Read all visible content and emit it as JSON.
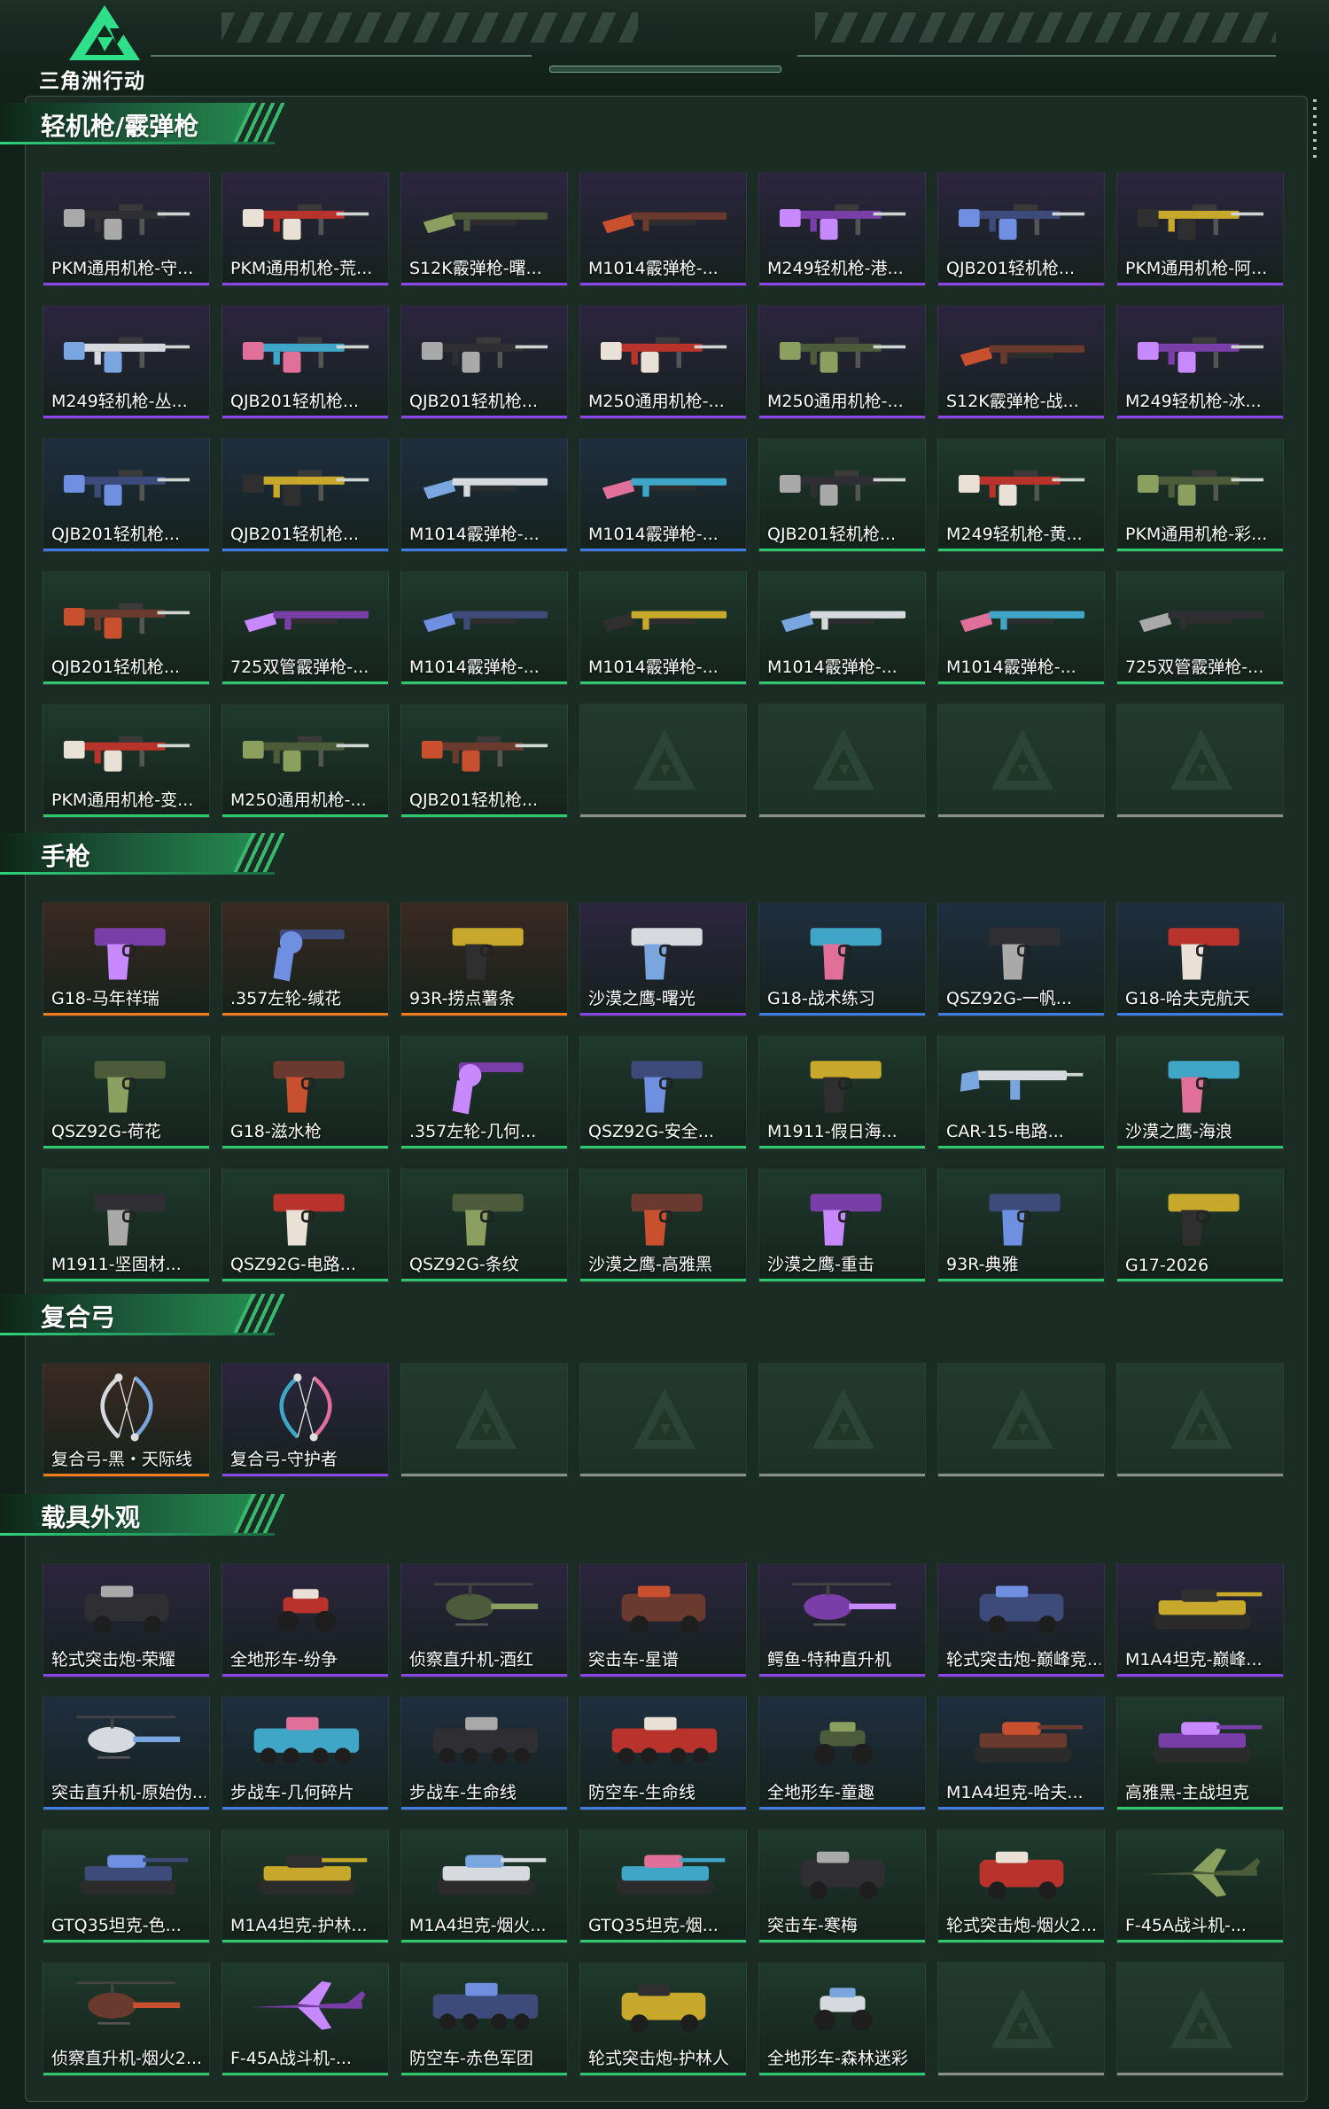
{
  "header": {
    "logo_text": "三角洲行动"
  },
  "rarity_colors": {
    "purple": "#8a46e6",
    "blue": "#3f7ee0",
    "green": "#2fc86c",
    "orange": "#ef7d1c",
    "empty": "#8a8f8c"
  },
  "card_backgrounds": {
    "purple": "#2c2540",
    "blue": "#1f2f40",
    "green": "#1f3a2d",
    "orange": "#3a2a22"
  },
  "sections": [
    {
      "title": "轻机枪/霰弹枪",
      "items": [
        {
          "name": "PKM通用机枪-守...",
          "rarity": "purple",
          "icon": "machine-gun-icon"
        },
        {
          "name": "PKM通用机枪-荒...",
          "rarity": "purple",
          "icon": "machine-gun-icon"
        },
        {
          "name": "S12K霰弹枪-曙...",
          "rarity": "purple",
          "icon": "shotgun-icon"
        },
        {
          "name": "M1014霰弹枪-...",
          "rarity": "purple",
          "icon": "shotgun-icon"
        },
        {
          "name": "M249轻机枪-港...",
          "rarity": "purple",
          "icon": "machine-gun-icon"
        },
        {
          "name": "QJB201轻机枪...",
          "rarity": "purple",
          "icon": "machine-gun-icon"
        },
        {
          "name": "PKM通用机枪-阿...",
          "rarity": "purple",
          "icon": "machine-gun-icon"
        },
        {
          "name": "M249轻机枪-丛...",
          "rarity": "purple",
          "icon": "machine-gun-icon"
        },
        {
          "name": "QJB201轻机枪...",
          "rarity": "purple",
          "icon": "machine-gun-icon"
        },
        {
          "name": "QJB201轻机枪...",
          "rarity": "purple",
          "icon": "machine-gun-icon"
        },
        {
          "name": "M250通用机枪-...",
          "rarity": "purple",
          "icon": "machine-gun-icon"
        },
        {
          "name": "M250通用机枪-...",
          "rarity": "purple",
          "icon": "machine-gun-icon"
        },
        {
          "name": "S12K霰弹枪-战...",
          "rarity": "purple",
          "icon": "shotgun-icon"
        },
        {
          "name": "M249轻机枪-冰...",
          "rarity": "purple",
          "icon": "machine-gun-icon"
        },
        {
          "name": "QJB201轻机枪...",
          "rarity": "blue",
          "icon": "machine-gun-icon"
        },
        {
          "name": "QJB201轻机枪...",
          "rarity": "blue",
          "icon": "machine-gun-icon"
        },
        {
          "name": "M1014霰弹枪-...",
          "rarity": "blue",
          "icon": "shotgun-icon"
        },
        {
          "name": "M1014霰弹枪-...",
          "rarity": "blue",
          "icon": "shotgun-icon"
        },
        {
          "name": "QJB201轻机枪...",
          "rarity": "green",
          "icon": "machine-gun-icon"
        },
        {
          "name": "M249轻机枪-黄...",
          "rarity": "green",
          "icon": "machine-gun-icon"
        },
        {
          "name": "PKM通用机枪-彩...",
          "rarity": "green",
          "icon": "machine-gun-icon"
        },
        {
          "name": "QJB201轻机枪...",
          "rarity": "green",
          "icon": "machine-gun-icon"
        },
        {
          "name": "725双管霰弹枪-...",
          "rarity": "green",
          "icon": "shotgun-icon"
        },
        {
          "name": "M1014霰弹枪-...",
          "rarity": "green",
          "icon": "shotgun-icon"
        },
        {
          "name": "M1014霰弹枪-...",
          "rarity": "green",
          "icon": "shotgun-icon"
        },
        {
          "name": "M1014霰弹枪-...",
          "rarity": "green",
          "icon": "shotgun-icon"
        },
        {
          "name": "M1014霰弹枪-...",
          "rarity": "green",
          "icon": "shotgun-icon"
        },
        {
          "name": "725双管霰弹枪-...",
          "rarity": "green",
          "icon": "shotgun-icon"
        },
        {
          "name": "PKM通用机枪-变...",
          "rarity": "green",
          "icon": "machine-gun-icon"
        },
        {
          "name": "M250通用机枪-...",
          "rarity": "green",
          "icon": "machine-gun-icon"
        },
        {
          "name": "QJB201轻机枪...",
          "rarity": "green",
          "icon": "machine-gun-icon"
        }
      ],
      "empty_slots": 4
    },
    {
      "title": "手枪",
      "items": [
        {
          "name": "G18-马年祥瑞",
          "rarity": "orange",
          "icon": "pistol-icon"
        },
        {
          "name": ".357左轮-缄花",
          "rarity": "orange",
          "icon": "revolver-icon"
        },
        {
          "name": "93R-捞点薯条",
          "rarity": "orange",
          "icon": "pistol-icon"
        },
        {
          "name": "沙漠之鹰-曙光",
          "rarity": "purple",
          "icon": "pistol-icon"
        },
        {
          "name": "G18-战术练习",
          "rarity": "blue",
          "icon": "pistol-icon"
        },
        {
          "name": "QSZ92G-一帆...",
          "rarity": "blue",
          "icon": "pistol-icon"
        },
        {
          "name": "G18-哈夫克航天",
          "rarity": "blue",
          "icon": "pistol-icon"
        },
        {
          "name": "QSZ92G-荷花",
          "rarity": "green",
          "icon": "pistol-icon"
        },
        {
          "name": "G18-滋水枪",
          "rarity": "green",
          "icon": "pistol-icon"
        },
        {
          "name": ".357左轮-几何...",
          "rarity": "green",
          "icon": "revolver-icon"
        },
        {
          "name": "QSZ92G-安全...",
          "rarity": "green",
          "icon": "pistol-icon"
        },
        {
          "name": "M1911-假日海...",
          "rarity": "green",
          "icon": "pistol-icon"
        },
        {
          "name": "CAR-15-电路...",
          "rarity": "green",
          "icon": "rifle-icon"
        },
        {
          "name": "沙漠之鹰-海浪",
          "rarity": "green",
          "icon": "pistol-icon"
        },
        {
          "name": "M1911-坚固材...",
          "rarity": "green",
          "icon": "pistol-icon"
        },
        {
          "name": "QSZ92G-电路...",
          "rarity": "green",
          "icon": "pistol-icon"
        },
        {
          "name": "QSZ92G-条纹",
          "rarity": "green",
          "icon": "pistol-icon"
        },
        {
          "name": "沙漠之鹰-高雅黑",
          "rarity": "green",
          "icon": "pistol-icon"
        },
        {
          "name": "沙漠之鹰-重击",
          "rarity": "green",
          "icon": "pistol-icon"
        },
        {
          "name": "93R-典雅",
          "rarity": "green",
          "icon": "pistol-icon"
        },
        {
          "name": "G17-2026",
          "rarity": "green",
          "icon": "pistol-icon"
        }
      ],
      "empty_slots": 0
    },
    {
      "title": "复合弓",
      "items": [
        {
          "name": "复合弓-黑・天际线",
          "rarity": "orange",
          "icon": "compound-bow-icon"
        },
        {
          "name": "复合弓-守护者",
          "rarity": "purple",
          "icon": "compound-bow-icon"
        }
      ],
      "empty_slots": 5
    },
    {
      "title": "载具外观",
      "items": [
        {
          "name": "轮式突击炮-荣耀",
          "rarity": "purple",
          "icon": "armored-car-icon"
        },
        {
          "name": "全地形车-纷争",
          "rarity": "purple",
          "icon": "atv-icon"
        },
        {
          "name": "侦察直升机-酒红",
          "rarity": "purple",
          "icon": "helicopter-icon"
        },
        {
          "name": "突击车-星谱",
          "rarity": "purple",
          "icon": "armored-car-icon"
        },
        {
          "name": "鳄鱼-特种直升机",
          "rarity": "purple",
          "icon": "helicopter-icon"
        },
        {
          "name": "轮式突击炮-巅峰竞...",
          "rarity": "purple",
          "icon": "armored-car-icon"
        },
        {
          "name": "M1A4坦克-巅峰...",
          "rarity": "purple",
          "icon": "tank-icon"
        },
        {
          "name": "突击直升机-原始伪...",
          "rarity": "blue",
          "icon": "helicopter-icon"
        },
        {
          "name": "步战车-几何碎片",
          "rarity": "blue",
          "icon": "ifv-icon"
        },
        {
          "name": "步战车-生命线",
          "rarity": "blue",
          "icon": "ifv-icon"
        },
        {
          "name": "防空车-生命线",
          "rarity": "blue",
          "icon": "ifv-icon"
        },
        {
          "name": "全地形车-童趣",
          "rarity": "blue",
          "icon": "atv-icon"
        },
        {
          "name": "M1A4坦克-哈夫...",
          "rarity": "blue",
          "icon": "tank-icon"
        },
        {
          "name": "高雅黑-主战坦克",
          "rarity": "green",
          "icon": "tank-icon"
        },
        {
          "name": "GTQ35坦克-色...",
          "rarity": "green",
          "icon": "tank-icon"
        },
        {
          "name": "M1A4坦克-护林...",
          "rarity": "green",
          "icon": "tank-icon"
        },
        {
          "name": "M1A4坦克-烟火...",
          "rarity": "green",
          "icon": "tank-icon"
        },
        {
          "name": "GTQ35坦克-烟...",
          "rarity": "green",
          "icon": "tank-icon"
        },
        {
          "name": "突击车-寒梅",
          "rarity": "green",
          "icon": "armored-car-icon"
        },
        {
          "name": "轮式突击炮-烟火2...",
          "rarity": "green",
          "icon": "armored-car-icon"
        },
        {
          "name": "F-45A战斗机-...",
          "rarity": "green",
          "icon": "fighter-jet-icon"
        },
        {
          "name": "侦察直升机-烟火2...",
          "rarity": "green",
          "icon": "helicopter-icon"
        },
        {
          "name": "F-45A战斗机-...",
          "rarity": "green",
          "icon": "fighter-jet-icon"
        },
        {
          "name": "防空车-赤色军团",
          "rarity": "green",
          "icon": "ifv-icon"
        },
        {
          "name": "轮式突击炮-护林人",
          "rarity": "green",
          "icon": "armored-car-icon"
        },
        {
          "name": "全地形车-森林迷彩",
          "rarity": "green",
          "icon": "atv-icon"
        }
      ],
      "empty_slots": 2
    }
  ]
}
